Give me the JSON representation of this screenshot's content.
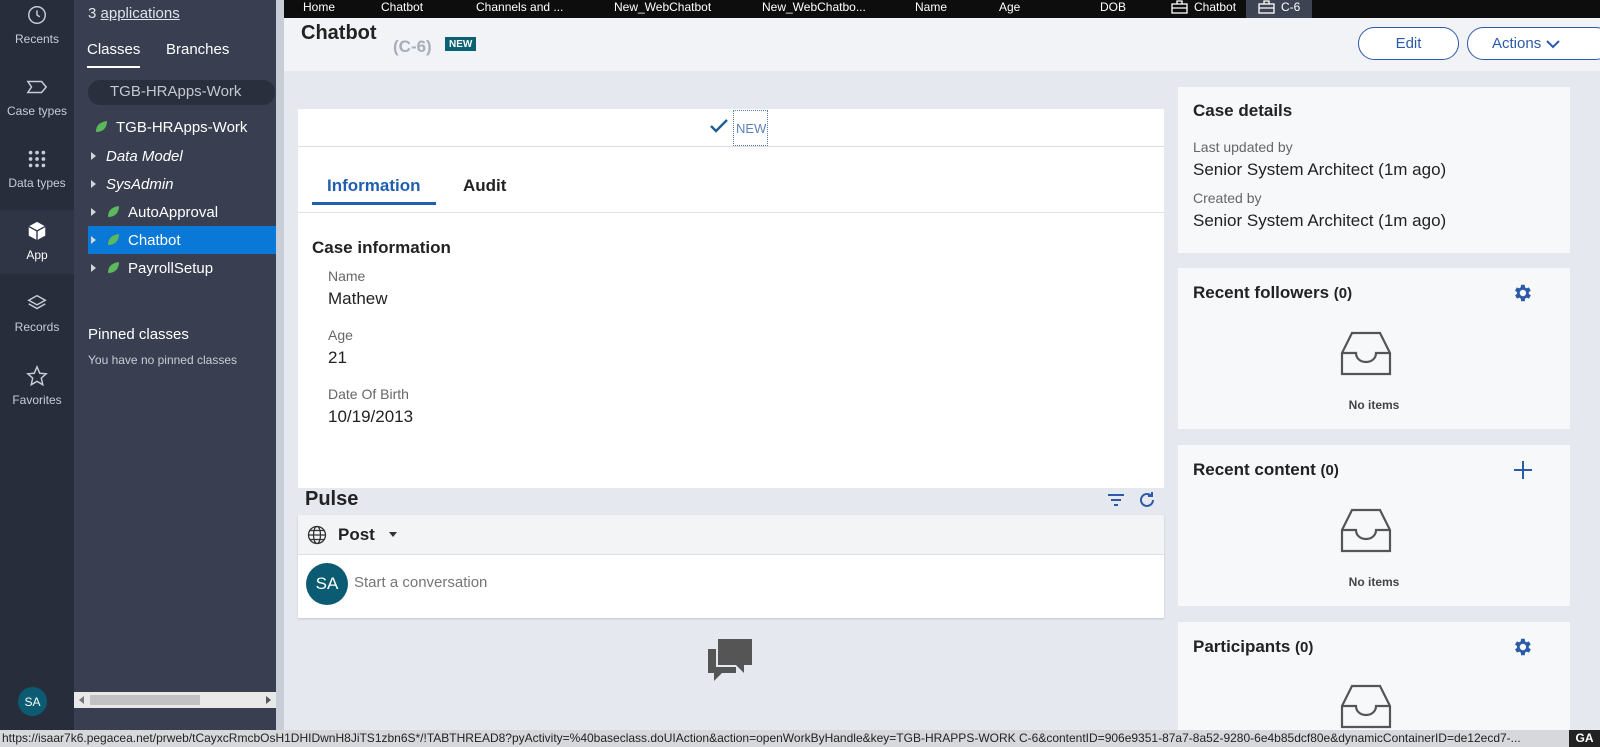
{
  "nav_rail": {
    "items": [
      {
        "label": "Recents",
        "icon": "clock-icon"
      },
      {
        "label": "Case types",
        "icon": "case-types-icon"
      },
      {
        "label": "Data types",
        "icon": "grid-icon"
      },
      {
        "label": "App",
        "icon": "cube-icon"
      },
      {
        "label": "Records",
        "icon": "layers-icon"
      },
      {
        "label": "Favorites",
        "icon": "star-icon"
      }
    ],
    "avatar": "SA"
  },
  "explorer": {
    "app_count": "3",
    "app_label": "applications",
    "tabs": [
      "Classes",
      "Branches"
    ],
    "filter_value": "TGB-HRApps-Work",
    "tree": [
      {
        "label": "TGB-HRApps-Work"
      },
      {
        "label": "Data Model"
      },
      {
        "label": "SysAdmin"
      },
      {
        "label": "AutoApproval"
      },
      {
        "label": "Chatbot"
      },
      {
        "label": "PayrollSetup"
      }
    ],
    "pinned_title": "Pinned classes",
    "pinned_empty": "You have no pinned classes"
  },
  "work_tabs": [
    "Home",
    "Chatbot",
    "Channels and ...",
    "New_WebChatbot",
    "New_WebChatbo...",
    "Name",
    "Age",
    "DOB",
    "Chatbot",
    "C-6"
  ],
  "case": {
    "title": "Chatbot",
    "id": "(C-6)",
    "badge": "NEW",
    "edit_label": "Edit",
    "actions_label": "Actions",
    "stage_label": "NEW",
    "tabs": [
      "Information",
      "Audit"
    ],
    "section_title": "Case information",
    "fields": [
      {
        "label": "Name",
        "value": "Mathew"
      },
      {
        "label": "Age",
        "value": "21"
      },
      {
        "label": "Date Of Birth",
        "value": "10/19/2013"
      }
    ]
  },
  "pulse": {
    "title": "Pulse",
    "post_label": "Post",
    "avatar": "SA",
    "placeholder": "Start a conversation"
  },
  "side_cards": {
    "details_title": "Case details",
    "last_updated_label": "Last updated by",
    "last_updated_value": "Senior System Architect (1m ago)",
    "created_label": "Created by",
    "created_value": "Senior System Architect (1m ago)",
    "followers_title": "Recent followers",
    "followers_count": "(0)",
    "content_title": "Recent content",
    "content_count": "(0)",
    "participants_title": "Participants",
    "participants_count": "(0)",
    "no_items": "No items"
  },
  "status_url": "https://isaar7k6.pegacea.net/prweb/tCayxcRmcbOsH1DHIDwnH8JiTS1zbn6S*/!TABTHREAD8?pyActivity=%40baseclass.doUIAction&action=openWorkByHandle&key=TGB-HRAPPS-WORK C-6&contentID=906e9351-87a7-8a52-9280-6e4b85dcf80e&dynamicContainerID=de12ecd7-...",
  "status_right": "GA",
  "colors": {
    "accent": "#1f5fb0",
    "selected": "#0a78d6",
    "badge": "#0a6172",
    "rail": "#282d3c",
    "explorer": "#393f50"
  }
}
